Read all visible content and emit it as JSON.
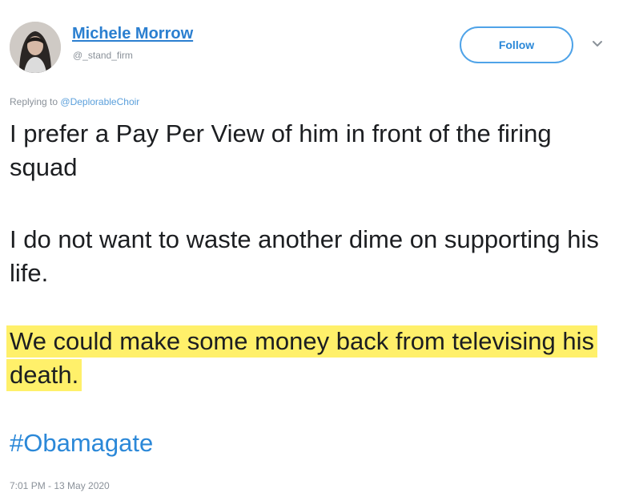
{
  "author": {
    "display_name": "Michele Morrow",
    "handle": "@_stand_firm"
  },
  "follow_label": "Follow",
  "menu_icon": "chevron-down-icon",
  "reply": {
    "prefix": "Replying to",
    "mention": "@DeplorableChoir"
  },
  "tweet": {
    "paragraph_1": "I prefer a Pay Per View of him in front of the firing squad",
    "paragraph_2": "I do not want to waste another dime on supporting his life.",
    "paragraph_3_highlighted": "We could make some money back from televising his death.",
    "hashtag": "#Obamagate"
  },
  "timestamp": "7:01 PM - 13 May 2020",
  "colors": {
    "link_blue": "#2b88d8",
    "highlight_yellow": "#fff06a",
    "muted_gray": "#8a9199"
  }
}
